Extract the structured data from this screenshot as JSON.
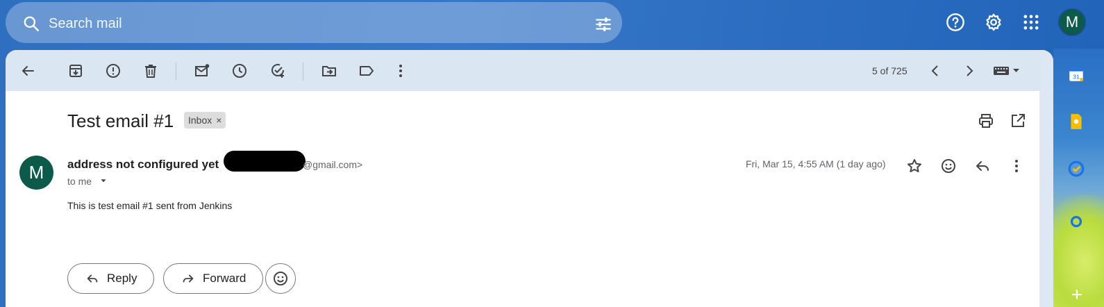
{
  "search": {
    "placeholder": "Search mail"
  },
  "account": {
    "avatar_letter": "M"
  },
  "toolbar": {
    "pager_text": "5 of 725"
  },
  "message": {
    "subject": "Test email #1",
    "label": "Inbox",
    "label_remove": "×",
    "sender_initial": "M",
    "sender_name": "address not configured yet",
    "sender_email_suffix": "@gmail.com>",
    "recipient": "to me",
    "date": "Fri, Mar 15, 4:55 AM (1 day ago)",
    "body": "This is test email #1 sent from Jenkins"
  },
  "actions": {
    "reply_label": "Reply",
    "forward_label": "Forward"
  },
  "side_panel": {
    "calendar_day": "31"
  },
  "colors": {
    "avatar": "#0c5a4a",
    "toolbar_bg": "#dbe6f3",
    "background": "#2f6fc0"
  }
}
